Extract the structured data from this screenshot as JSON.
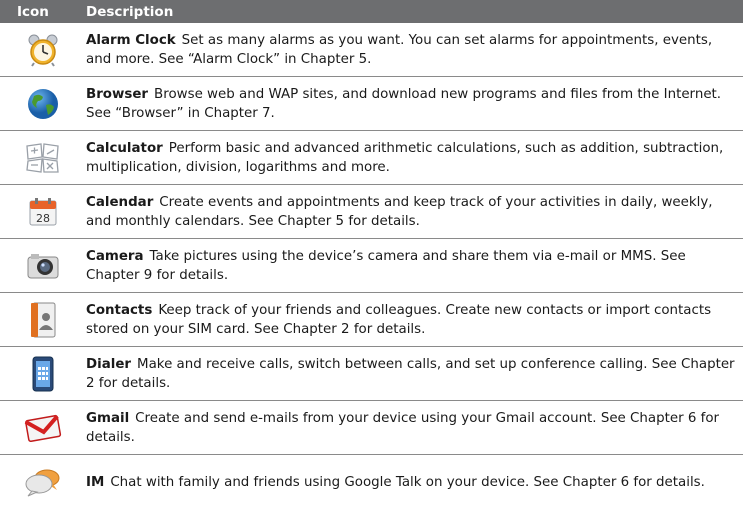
{
  "header": {
    "icon": "Icon",
    "description": "Description"
  },
  "rows": [
    {
      "icon": "alarm-clock-icon",
      "name": "Alarm Clock",
      "text": "Set as many alarms as you want. You can set alarms for appointments, events, and more. See “Alarm Clock” in Chapter 5."
    },
    {
      "icon": "browser-globe-icon",
      "name": "Browser",
      "text": "Browse web and WAP sites, and download new programs and files from the Internet. See “Browser” in Chapter 7."
    },
    {
      "icon": "calculator-icon",
      "name": "Calculator",
      "text": "Perform basic and advanced arithmetic calculations, such as addition, subtraction, multiplication, division, logarithms and more."
    },
    {
      "icon": "calendar-icon",
      "name": "Calendar",
      "text": "Create events and appointments and keep track of your activities in daily, weekly, and monthly calendars. See Chapter 5 for details.",
      "icon_label": "28"
    },
    {
      "icon": "camera-icon",
      "name": "Camera",
      "text": "Take pictures using the device’s camera and share them via e-mail or MMS. See Chapter 9 for details."
    },
    {
      "icon": "contacts-icon",
      "name": "Contacts",
      "text": "Keep track of your friends and colleagues. Create new contacts or import contacts stored on your SIM card. See Chapter 2 for details."
    },
    {
      "icon": "dialer-icon",
      "name": "Dialer",
      "text": "Make and receive calls, switch between calls, and set up conference calling. See Chapter 2 for details."
    },
    {
      "icon": "gmail-icon",
      "name": "Gmail",
      "text": "Create and send e-mails from your device using your Gmail account. See Chapter 6 for details."
    },
    {
      "icon": "im-chat-icon",
      "name": "IM",
      "text": "Chat with family and friends using Google Talk on your device. See Chapter 6 for details."
    }
  ]
}
